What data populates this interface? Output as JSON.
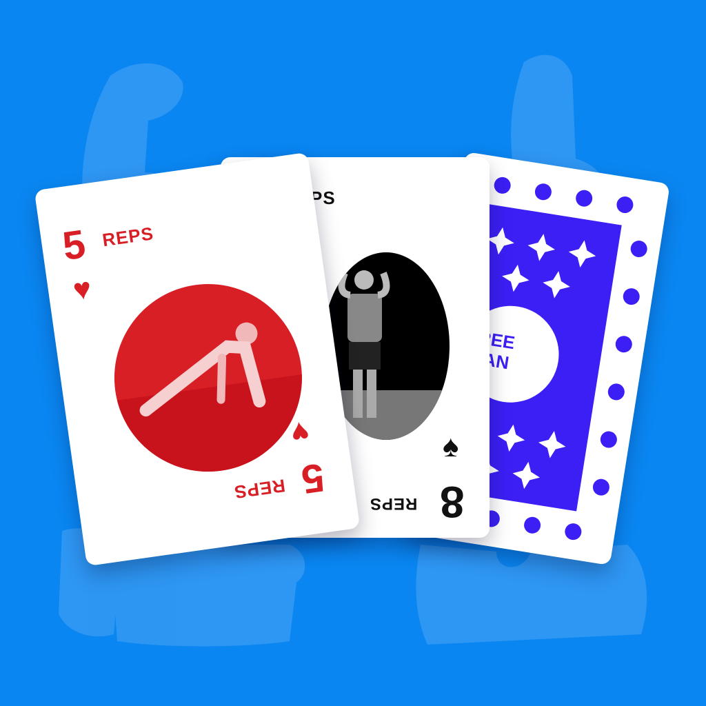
{
  "colors": {
    "background": "#0a86f2",
    "hearts": "#d91f26",
    "spades": "#111111",
    "card_back": "#3b1ff5"
  },
  "cards": {
    "hearts_card": {
      "rank": "5",
      "label": "REPS",
      "suit": "♥",
      "exercise": "push-up"
    },
    "spades_card": {
      "rank": "8",
      "label": "REPS",
      "label_visible_top": "PS",
      "suit": "♠",
      "exercise": "squat"
    },
    "back_card": {
      "text_line1": "REE",
      "text_line2": "AN"
    }
  }
}
